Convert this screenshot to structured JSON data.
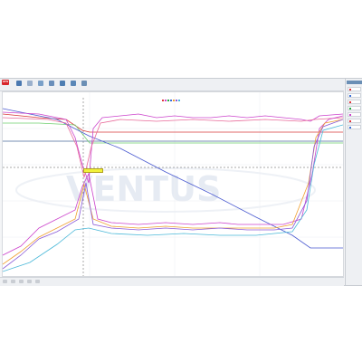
{
  "app": {
    "logo_text": "ATS",
    "toolbar": [
      {
        "icon": "trigger-icon",
        "label": "",
        "color": "#d8262c"
      },
      {
        "icon": "settings-icon",
        "label": "",
        "color": "#4a78b0"
      },
      {
        "icon": "cursor-icon",
        "label": "",
        "color": "#7a9ac4"
      },
      {
        "icon": "zoom-icon",
        "label": "",
        "color": "#7aa0c8"
      },
      {
        "icon": "grid-icon",
        "label": "",
        "color": "#6a8fba"
      },
      {
        "icon": "save-icon",
        "label": "",
        "color": "#4e7eb2"
      },
      {
        "icon": "export-icon",
        "label": "",
        "color": "#5b88b8"
      },
      {
        "icon": "print-icon",
        "label": "",
        "color": "#6b8fb5"
      }
    ]
  },
  "right_panel": {
    "title": "",
    "items": [
      {
        "color": "#e0343b"
      },
      {
        "color": "#3a6fd8"
      },
      {
        "color": "#e0343b"
      },
      {
        "color": "#22aa44"
      },
      {
        "color": "#cc44cc"
      },
      {
        "color": "#e0343b"
      },
      {
        "color": "#3a6fd8"
      }
    ]
  },
  "cursor_readout": "",
  "watermark_text": "VENTUS",
  "watermark_sub": "",
  "colors": {
    "magenta": "#cc44cc",
    "purple": "#8a5ad8",
    "red": "#d83a3a",
    "green": "#6fcf6f",
    "orange": "#f0a030",
    "blue": "#4a5ad0",
    "navy": "#4a6a9a",
    "cyan": "#4ab8d8",
    "pink": "#e86a9a"
  }
}
